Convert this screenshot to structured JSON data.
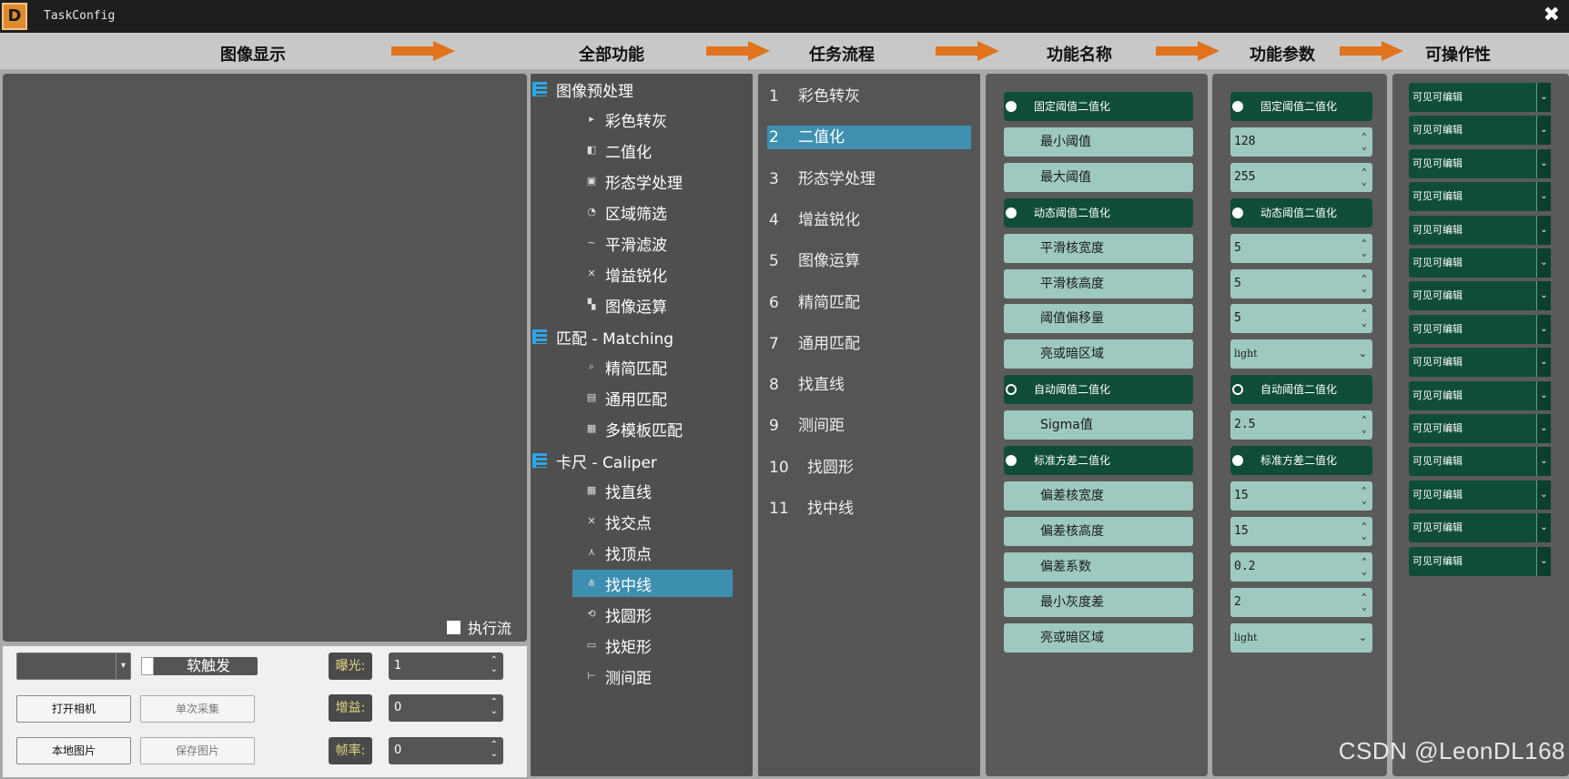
{
  "window": {
    "title": "TaskConfig",
    "logo_letter": "D",
    "close": "✖"
  },
  "headers": {
    "image_display": "图像显示",
    "all_functions": "全部功能",
    "task_flow": "任务流程",
    "function_name": "功能名称",
    "function_params": "功能参数",
    "operability": "可操作性"
  },
  "image_panel": {
    "exec_flow_label": "执行流"
  },
  "camera": {
    "camera_select": "",
    "soft_trigger": "软触发",
    "open_camera": "打开相机",
    "single_capture": "单次采集",
    "local_image": "本地图片",
    "save_image": "保存图片",
    "exposure_label": "曝光:",
    "exposure_value": "1",
    "gain_label": "增益:",
    "gain_value": "0",
    "framerate_label": "帧率:",
    "framerate_value": "0"
  },
  "all_functions": {
    "groups": [
      {
        "label": "图像预处理",
        "items": [
          "彩色转灰",
          "二值化",
          "形态学处理",
          "区域筛选",
          "平滑滤波",
          "增益锐化",
          "图像运算"
        ]
      },
      {
        "label": "匹配 - Matching",
        "items": [
          "精简匹配",
          "通用匹配",
          "多模板匹配"
        ]
      },
      {
        "label": "卡尺 - Caliper",
        "items": [
          "找直线",
          "找交点",
          "找顶点",
          "找中线",
          "找圆形",
          "找矩形",
          "测间距"
        ]
      }
    ],
    "selected": "找中线"
  },
  "task_flow": {
    "items": [
      {
        "num": "1",
        "label": "彩色转灰"
      },
      {
        "num": "2",
        "label": "二值化"
      },
      {
        "num": "3",
        "label": "形态学处理"
      },
      {
        "num": "4",
        "label": "增益锐化"
      },
      {
        "num": "5",
        "label": "图像运算"
      },
      {
        "num": "6",
        "label": "精简匹配"
      },
      {
        "num": "7",
        "label": "通用匹配"
      },
      {
        "num": "8",
        "label": "找直线"
      },
      {
        "num": "9",
        "label": "测间距"
      },
      {
        "num": "10",
        "label": "找圆形"
      },
      {
        "num": "11",
        "label": "找中线"
      }
    ],
    "selected_index": 1
  },
  "function_names": [
    {
      "kind": "head",
      "label": "固定阈值二值化",
      "radio": "filled"
    },
    {
      "kind": "item",
      "label": "最小阈值"
    },
    {
      "kind": "item",
      "label": "最大阈值"
    },
    {
      "kind": "head",
      "label": "动态阈值二值化",
      "radio": "filled"
    },
    {
      "kind": "item",
      "label": "平滑核宽度"
    },
    {
      "kind": "item",
      "label": "平滑核高度"
    },
    {
      "kind": "item",
      "label": "阈值偏移量"
    },
    {
      "kind": "item",
      "label": "亮或暗区域"
    },
    {
      "kind": "head",
      "label": "自动阈值二值化",
      "radio": "hollow"
    },
    {
      "kind": "item",
      "label": "Sigma值"
    },
    {
      "kind": "head",
      "label": "标准方差二值化",
      "radio": "filled"
    },
    {
      "kind": "item",
      "label": "偏差核宽度"
    },
    {
      "kind": "item",
      "label": "偏差核高度"
    },
    {
      "kind": "item",
      "label": "偏差系数"
    },
    {
      "kind": "item",
      "label": "最小灰度差"
    },
    {
      "kind": "item",
      "label": "亮或暗区域"
    }
  ],
  "function_params": [
    {
      "kind": "head",
      "label": "固定阈值二值化",
      "radio": "filled"
    },
    {
      "kind": "spin",
      "value": "128"
    },
    {
      "kind": "spin",
      "value": "255"
    },
    {
      "kind": "head",
      "label": "动态阈值二值化",
      "radio": "filled"
    },
    {
      "kind": "spin",
      "value": "5"
    },
    {
      "kind": "spin",
      "value": "5"
    },
    {
      "kind": "spin",
      "value": "5"
    },
    {
      "kind": "combo",
      "value": "light"
    },
    {
      "kind": "head",
      "label": "自动阈值二值化",
      "radio": "hollow"
    },
    {
      "kind": "spin",
      "value": "2.5"
    },
    {
      "kind": "head",
      "label": "标准方差二值化",
      "radio": "filled"
    },
    {
      "kind": "spin",
      "value": "15"
    },
    {
      "kind": "spin",
      "value": "15"
    },
    {
      "kind": "spin",
      "value": "0.2"
    },
    {
      "kind": "spin",
      "value": "2"
    },
    {
      "kind": "combo",
      "value": "light"
    }
  ],
  "operability": [
    "可见可编辑",
    "可见可编辑",
    "可见可编辑",
    "可见可编辑",
    "可见可编辑",
    "可见可编辑",
    "可见可编辑",
    "可见可编辑",
    "可见可编辑",
    "可见可编辑",
    "可见可编辑",
    "可见可编辑",
    "可见可编辑",
    "可见可编辑",
    "可见可编辑"
  ],
  "icons": {
    "group": "list-icon",
    "spin": "updown-arrows-icon",
    "dropdown": "chevron-down-icon"
  },
  "colors": {
    "accent_dark_green": "#0f4d3a",
    "light_teal": "#9ec9c0",
    "selection_blue": "#3d8fb0",
    "arrow_orange": "#e0731b"
  },
  "watermark": "CSDN @LeonDL168"
}
